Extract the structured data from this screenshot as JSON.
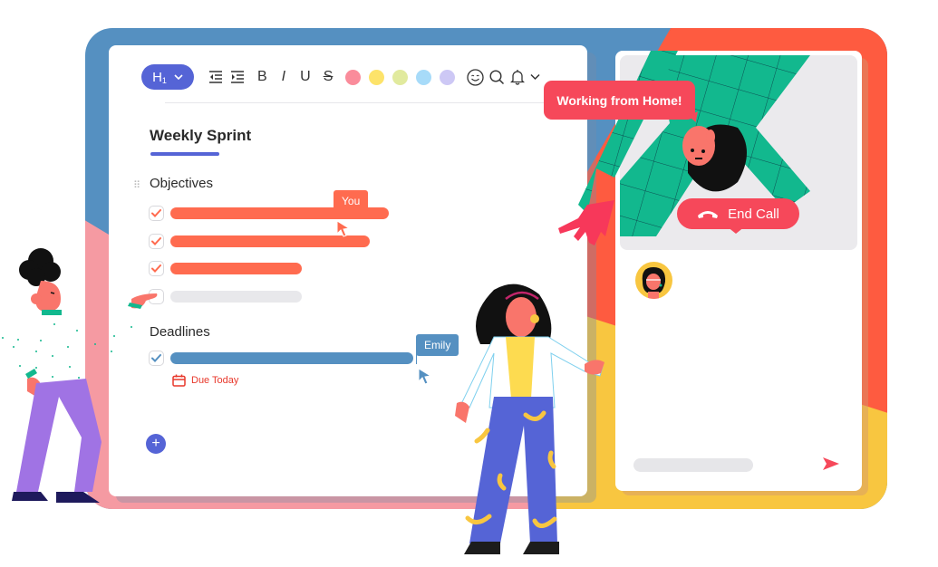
{
  "editor": {
    "toolbar": {
      "heading_button": {
        "label": "H",
        "level": "1"
      },
      "indent_decrease_icon": "outdent-icon",
      "indent_increase_icon": "indent-icon",
      "bold": "B",
      "italic": "I",
      "underline": "U",
      "strikethrough": "S",
      "color_swatches": [
        "#fa8c9b",
        "#fde36a",
        "#e1ea9e",
        "#a7dbf9",
        "#cdc8f5"
      ],
      "emoji_icon": "emoji-icon",
      "search_icon": "search-icon",
      "bell_icon": "bell-icon",
      "more_icon": "chevron-down-icon"
    },
    "title": "Weekly Sprint",
    "sections": [
      {
        "label": "Objectives",
        "tasks": [
          {
            "checked": true,
            "color": "#ff6b4f",
            "progress": 0.9
          },
          {
            "checked": true,
            "color": "#ff6b4f",
            "progress": 0.82
          },
          {
            "checked": true,
            "color": "#ff6b4f",
            "progress": 0.54
          },
          {
            "checked": false,
            "color": "#e8e8eb",
            "progress": 0.54
          }
        ]
      },
      {
        "label": "Deadlines",
        "tasks": [
          {
            "checked": true,
            "color": "#5590c1",
            "progress": 1.0,
            "due": "Due Today"
          }
        ]
      }
    ],
    "cursors": [
      {
        "name": "You",
        "color": "#ff6b4f"
      },
      {
        "name": "Emily",
        "color": "#5590c1"
      }
    ],
    "add_button": "+"
  },
  "call": {
    "speech_bubble": "Working from Home!",
    "end_call_label": "End Call",
    "send_icon": "send-icon"
  },
  "colors": {
    "accent": "#5564d6",
    "danger": "#f6485a",
    "due": "#e8382b"
  }
}
